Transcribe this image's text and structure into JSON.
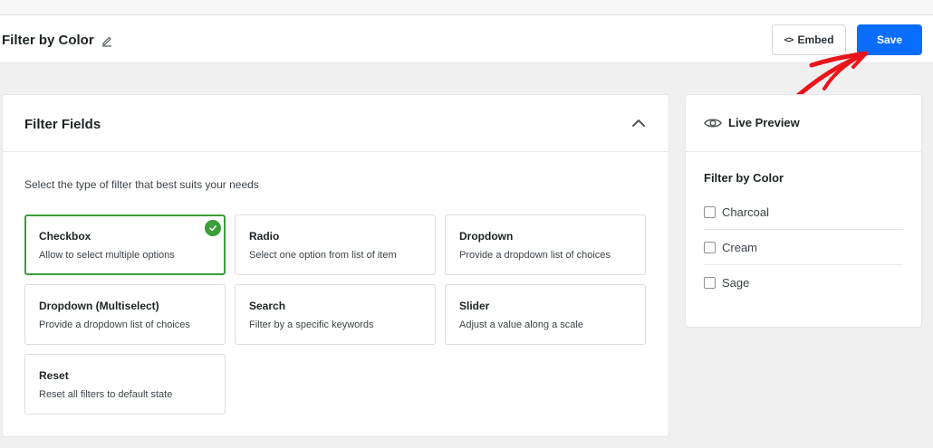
{
  "header": {
    "title": "Filter by Color",
    "embed_label": "Embed",
    "embed_icon": "code-icon",
    "save_label": "Save",
    "save_color": "#0a6dff"
  },
  "annotation": {
    "arrow_color": "#e8151b"
  },
  "filter_fields": {
    "title": "Filter Fields",
    "description": "Select the type of filter that best suits your needs",
    "options": [
      {
        "title": "Checkbox",
        "description": "Allow to select multiple options",
        "selected": true
      },
      {
        "title": "Radio",
        "description": "Select one option from list of item",
        "selected": false
      },
      {
        "title": "Dropdown",
        "description": "Provide a dropdown list of choices",
        "selected": false
      },
      {
        "title": "Dropdown (Multiselect)",
        "description": "Provide a dropdown list of choices",
        "selected": false
      },
      {
        "title": "Search",
        "description": "Filter by a specific keywords",
        "selected": false
      },
      {
        "title": "Slider",
        "description": "Adjust a value along a scale",
        "selected": false
      },
      {
        "title": "Reset",
        "description": "Reset all filters to default state",
        "selected": false
      }
    ],
    "selected_color": "#3a9e3a"
  },
  "live_preview": {
    "title": "Live Preview",
    "filter_title": "Filter by Color",
    "options": [
      "Charcoal",
      "Cream",
      "Sage"
    ]
  }
}
